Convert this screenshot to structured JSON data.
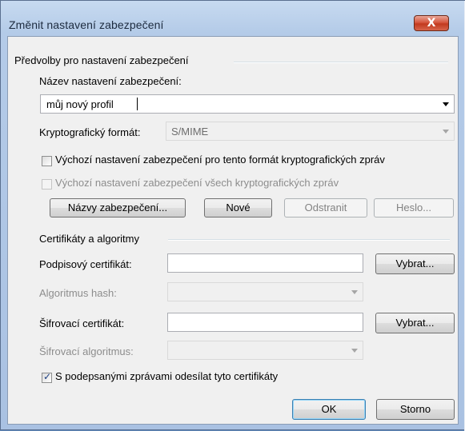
{
  "window": {
    "title": "Změnit nastavení zabezpečení",
    "close_glyph": "X"
  },
  "prefs_group": {
    "title": "Předvolby pro nastavení zabezpečení",
    "name_label": "Název nastavení zabezpečení:",
    "name_value": "můj nový profil",
    "crypto_format_label": "Kryptografický formát:",
    "crypto_format_value": "S/MIME",
    "default_for_format_label": "Výchozí nastavení zabezpečení pro tento formát kryptografických zpráv",
    "default_for_format_checked": false,
    "default_for_all_label": "Výchozí nastavení zabezpečení všech kryptografických zpráv",
    "default_for_all_checked": false,
    "buttons": {
      "labels_label": "Názvy zabezpečení...",
      "new_label": "Nové",
      "delete_label": "Odstranit",
      "password_label": "Heslo..."
    }
  },
  "certs_group": {
    "title": "Certifikáty a algoritmy",
    "signing_cert_label": "Podpisový certifikát:",
    "signing_cert_value": "",
    "choose1_label": "Vybrat...",
    "hash_algo_label": "Algoritmus hash:",
    "hash_algo_value": "",
    "encryption_cert_label": "Šifrovací certifikát:",
    "encryption_cert_value": "",
    "choose2_label": "Vybrat...",
    "encryption_algo_label": "Šifrovací algoritmus:",
    "encryption_algo_value": "",
    "send_certs_label": "S podepsanými zprávami odesílat tyto certifikáty",
    "send_certs_checked": true
  },
  "footer": {
    "ok_label": "OK",
    "cancel_label": "Storno"
  },
  "colors": {
    "title_bar": "#b4cbe8",
    "close_button": "#c23a1e",
    "dialog_bg": "#f0f0f0",
    "check_mark": "#1b3d80"
  }
}
